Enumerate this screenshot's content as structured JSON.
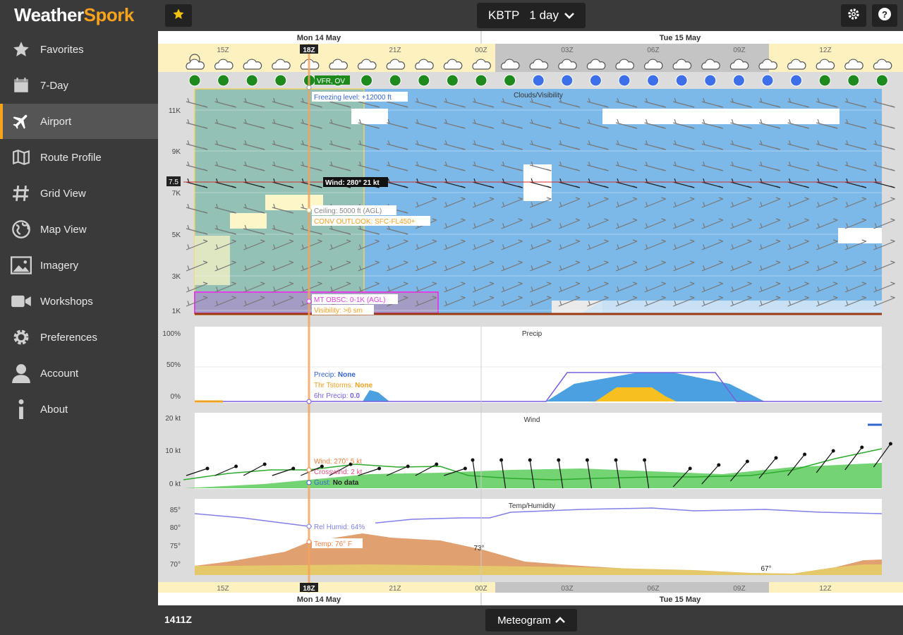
{
  "app": {
    "logo_part1": "Weather",
    "logo_part2": "Spork"
  },
  "sidebar": {
    "items": [
      {
        "label": "Favorites",
        "icon": "star-icon"
      },
      {
        "label": "7-Day",
        "icon": "calendar-icon"
      },
      {
        "label": "Airport",
        "icon": "airplane-icon",
        "active": true
      },
      {
        "label": "Route Profile",
        "icon": "map-fold-icon"
      },
      {
        "label": "Grid View",
        "icon": "hash-icon"
      },
      {
        "label": "Map View",
        "icon": "globe-icon"
      },
      {
        "label": "Imagery",
        "icon": "image-icon"
      },
      {
        "label": "Workshops",
        "icon": "video-icon"
      },
      {
        "label": "Preferences",
        "icon": "gear-icon"
      },
      {
        "label": "Account",
        "icon": "user-icon"
      },
      {
        "label": "About",
        "icon": "info-icon"
      }
    ]
  },
  "header": {
    "favorite_icon": "star-icon",
    "airport": "KBTP",
    "range": "1 day",
    "settings_icon": "gear-icon",
    "help_icon": "help-icon"
  },
  "timeline": {
    "day1": "Mon 14 May",
    "day2": "Tue 15 May",
    "current_hour": "18Z",
    "hour_labels": [
      "15Z",
      "21Z",
      "00Z",
      "03Z",
      "06Z",
      "09Z",
      "12Z"
    ]
  },
  "flight_category": {
    "label": "VFR, OV"
  },
  "panels": {
    "clouds": {
      "title": "Clouds/Visibility",
      "yticks": [
        "11K",
        "9K",
        "7K",
        "5K",
        "3K",
        "1K"
      ],
      "marker": "7.5",
      "freezing_level": "Freezing level: +12000 ft",
      "wind": "Wind: 280° 21 kt",
      "ceiling": "Ceiling: 5000 ft (AGL)",
      "conv_outlook": "CONV OUTLOOK: SFC-FL450+",
      "mt_obsc": "MT OBSC: 0-1K (AGL)",
      "visibility": "Visibility: >6 sm"
    },
    "precip": {
      "title": "Precip",
      "yticks": [
        "100%",
        "50%",
        "0%"
      ],
      "precip_label": "Precip:",
      "precip_value": "None",
      "thunder_label": "Thr Tstorms:",
      "thunder_value": "None",
      "six_hr_label": "6hr Precip:",
      "six_hr_value": "0.0"
    },
    "wind": {
      "title": "Wind",
      "yticks": [
        "20 kt",
        "10 kt",
        "0 kt"
      ],
      "wind_label": "Wind: 270° 5 kt",
      "crosswind_label": "Crosswind: 2 kt",
      "gust_label": "Gust:",
      "gust_value": "No data"
    },
    "temp": {
      "title": "Temp/Humidity",
      "yticks": [
        "85°",
        "80°",
        "75°",
        "70°"
      ],
      "humidity_label": "Rel Humid: 64%",
      "temp_label": "Temp: 76° F",
      "annot_73": "73°",
      "annot_67": "67°"
    }
  },
  "footer": {
    "time": "1411Z",
    "view": "Meteogram"
  },
  "colors": {
    "accent": "#f7a21b",
    "vfr_green": "#1e8a1e",
    "ifr_blue": "#3d6fe8",
    "sky_blue": "#7db9e8",
    "temp_orange": "#e0a070",
    "dew_yellow": "#e4c86a",
    "wind_green": "#5ccc5c"
  }
}
